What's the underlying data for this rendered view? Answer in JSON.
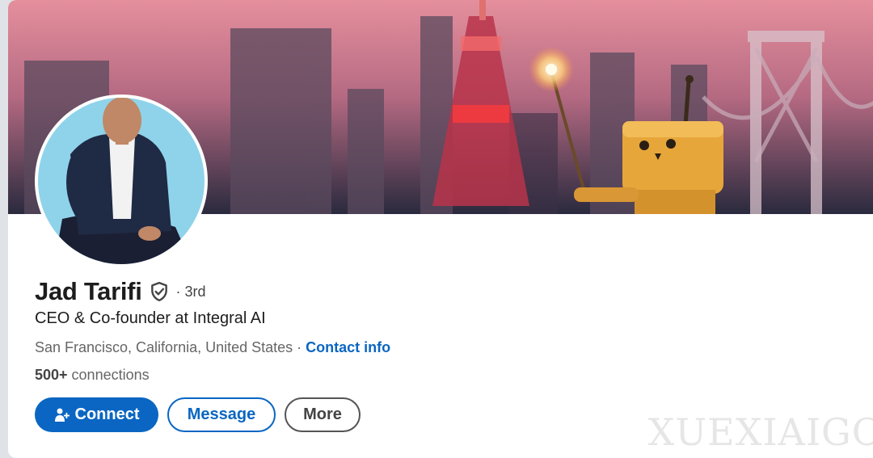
{
  "profile": {
    "name": "Jad Tarifi",
    "degree": "· 3rd",
    "headline": "CEO & Co-founder at Integral AI",
    "location": "San Francisco, California, United States",
    "separator": " · ",
    "contact_info_label": "Contact info",
    "connections_count": "500+",
    "connections_label": " connections"
  },
  "actions": {
    "connect_label": "Connect",
    "message_label": "Message",
    "more_label": "More"
  },
  "watermark": "XUEXIAIGC",
  "colors": {
    "accent": "#0a66c2",
    "text_primary": "#1d1d1d",
    "text_secondary": "#666666"
  },
  "icons": {
    "verified": "shield-check-icon",
    "connect": "add-person-icon"
  }
}
